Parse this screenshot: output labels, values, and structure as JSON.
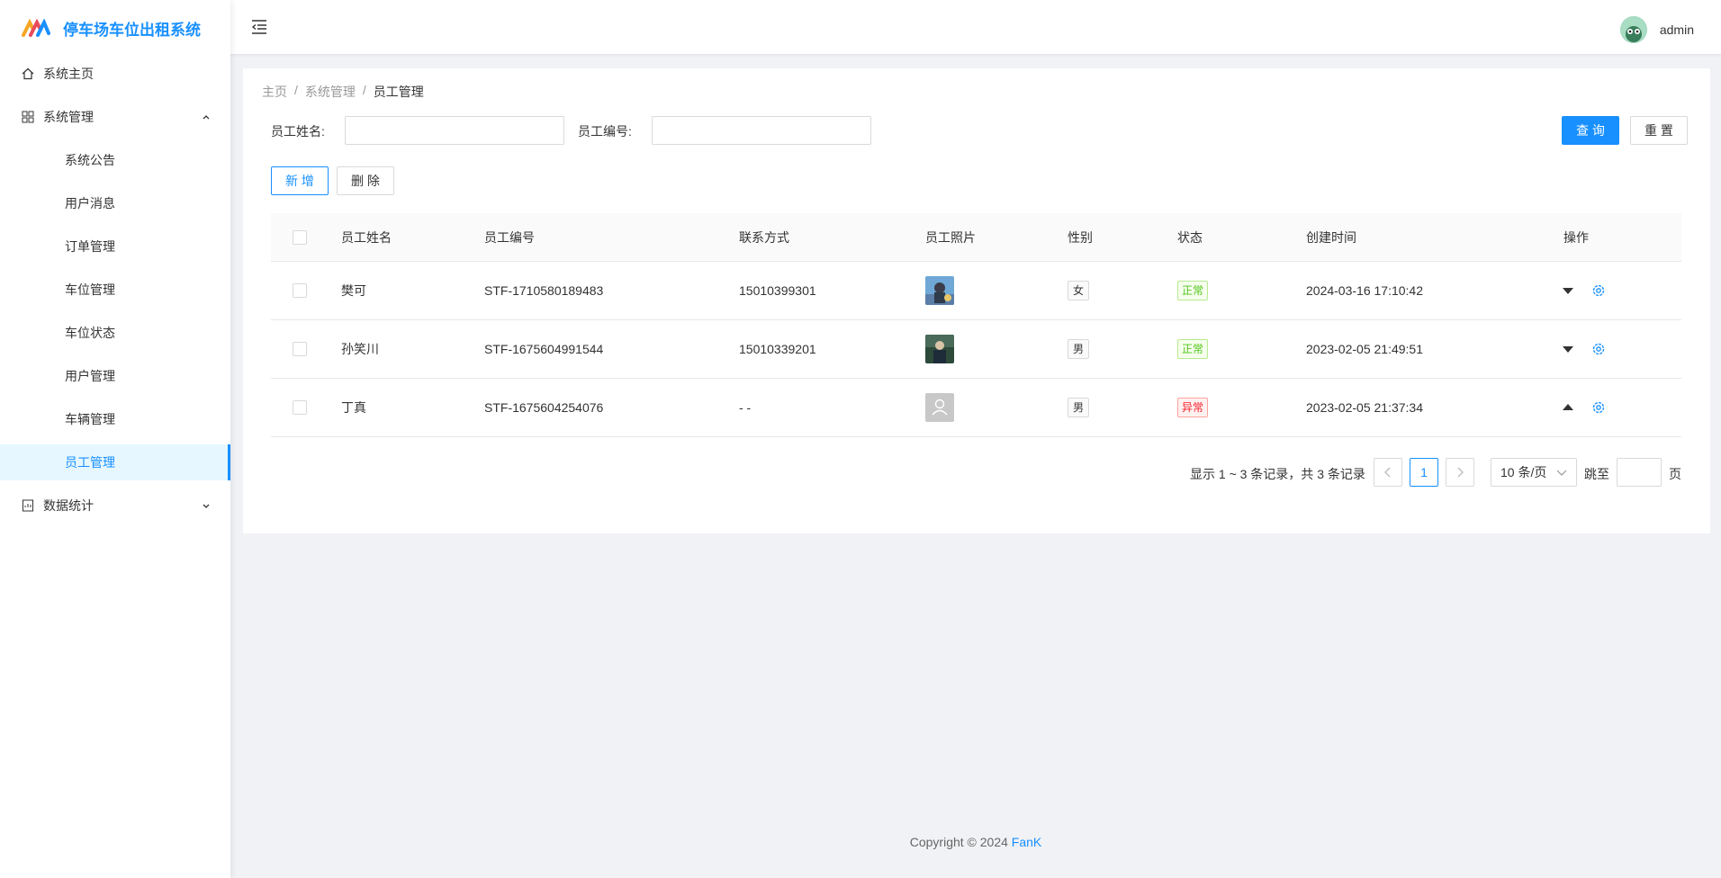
{
  "brand": {
    "title": "停车场车位出租系统"
  },
  "sidebar": {
    "home": "系统主页",
    "system": "系统管理",
    "sub_items": [
      "系统公告",
      "用户消息",
      "订单管理",
      "车位管理",
      "车位状态",
      "用户管理",
      "车辆管理",
      "员工管理"
    ],
    "stats": "数据统计"
  },
  "header": {
    "user": "admin"
  },
  "breadcrumb": [
    "主页",
    "系统管理",
    "员工管理"
  ],
  "search": {
    "name_label": "员工姓名:",
    "name_value": "",
    "no_label": "员工编号:",
    "no_value": "",
    "query": "查 询",
    "reset": "重 置"
  },
  "actions": {
    "add": "新 增",
    "delete": "删 除"
  },
  "table": {
    "columns": [
      "员工姓名",
      "员工编号",
      "联系方式",
      "员工照片",
      "性别",
      "状态",
      "创建时间",
      "操作"
    ],
    "rows": [
      {
        "name": "樊可",
        "no": "STF-1710580189483",
        "phone": "15010399301",
        "photo": "photo-a",
        "gender": "女",
        "status": "正常",
        "status_type": "ok",
        "created": "2024-03-16 17:10:42",
        "expand": "down"
      },
      {
        "name": "孙笑川",
        "no": "STF-1675604991544",
        "phone": "15010339201",
        "photo": "photo-b",
        "gender": "男",
        "status": "正常",
        "status_type": "ok",
        "created": "2023-02-05 21:49:51",
        "expand": "down"
      },
      {
        "name": "丁真",
        "no": "STF-1675604254076",
        "phone": "- -",
        "photo": "placeholder",
        "gender": "男",
        "status": "异常",
        "status_type": "bad",
        "created": "2023-02-05 21:37:34",
        "expand": "up"
      }
    ]
  },
  "pagination": {
    "summary": "显示 1 ~ 3 条记录，共 3 条记录",
    "current_page": "1",
    "page_size": "10 条/页",
    "jump_label": "跳至",
    "page_suffix": "页"
  },
  "footer": {
    "text": "Copyright © 2024 ",
    "author": "FanK"
  },
  "colors": {
    "primary": "#1890ff",
    "ok": "#52c41a",
    "bad": "#f5222d"
  }
}
